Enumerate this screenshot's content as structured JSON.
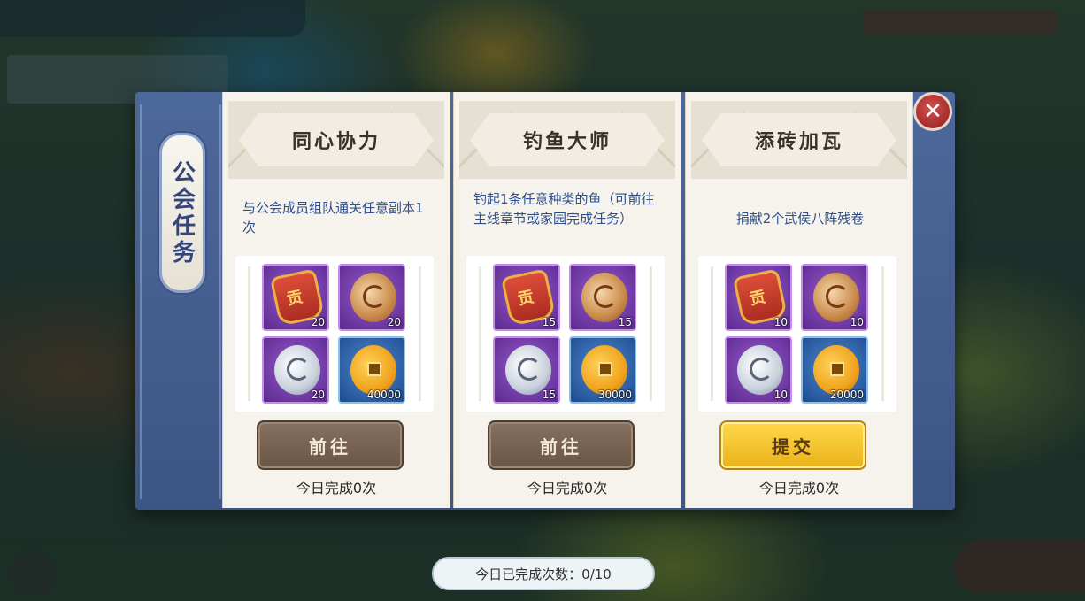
{
  "panel_tab": "公会任务",
  "tasks": [
    {
      "title": "同心协力",
      "description": "与公会成员组队通关任意副本1次",
      "rewards": [
        {
          "icon": "contribution-token-icon",
          "count": "20",
          "rarity": "purple"
        },
        {
          "icon": "gold-dragon-medal-icon",
          "count": "20",
          "rarity": "purple"
        },
        {
          "icon": "silver-dragon-medal-icon",
          "count": "20",
          "rarity": "purple"
        },
        {
          "icon": "copper-coin-icon",
          "count": "40000",
          "rarity": "blue"
        }
      ],
      "button": "前往",
      "daily_status": "今日完成0次"
    },
    {
      "title": "钓鱼大师",
      "description": "钓起1条任意种类的鱼（可前往主线章节或家园完成任务）",
      "rewards": [
        {
          "icon": "contribution-token-icon",
          "count": "15",
          "rarity": "purple"
        },
        {
          "icon": "gold-dragon-medal-icon",
          "count": "15",
          "rarity": "purple"
        },
        {
          "icon": "silver-dragon-medal-icon",
          "count": "15",
          "rarity": "purple"
        },
        {
          "icon": "copper-coin-icon",
          "count": "30000",
          "rarity": "blue"
        }
      ],
      "button": "前往",
      "daily_status": "今日完成0次"
    },
    {
      "title": "添砖加瓦",
      "description": "捐献2个武侯八阵残卷",
      "rewards": [
        {
          "icon": "contribution-token-icon",
          "count": "10",
          "rarity": "purple"
        },
        {
          "icon": "gold-dragon-medal-icon",
          "count": "10",
          "rarity": "purple"
        },
        {
          "icon": "silver-dragon-medal-icon",
          "count": "10",
          "rarity": "purple"
        },
        {
          "icon": "copper-coin-icon",
          "count": "20000",
          "rarity": "blue"
        }
      ],
      "button": "提交",
      "daily_status": "今日完成0次"
    }
  ],
  "close_icon": "close-icon",
  "total_counter": "今日已完成次数：0/10",
  "colors": {
    "frame": "#4d689a",
    "go_button": "#6b5545",
    "submit_button": "#eab21a",
    "description_text": "#2f4f8c"
  }
}
